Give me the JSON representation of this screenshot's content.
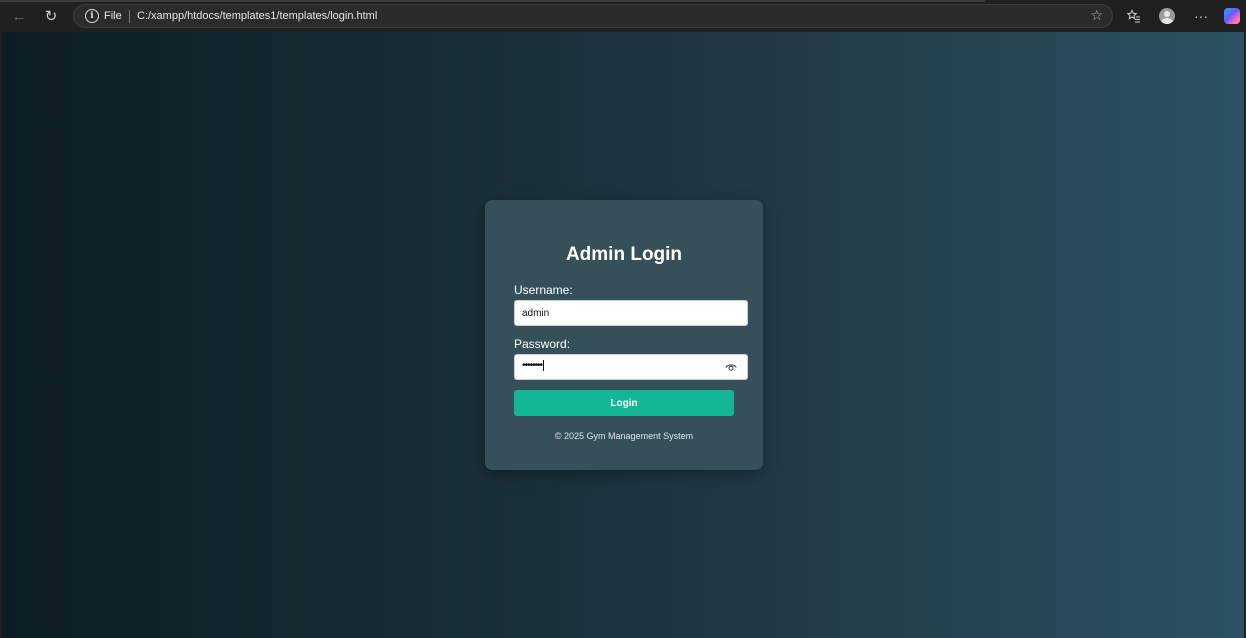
{
  "browser": {
    "back_icon": "←",
    "reload_icon": "↻",
    "info_icon": "i",
    "scheme": "File",
    "url": "C:/xampp/htdocs/templates1/templates/login.html",
    "star_icon": "☆",
    "favorites_icon": "☆",
    "menu_icon": "···"
  },
  "login": {
    "title": "Admin Login",
    "username_label": "Username:",
    "username_value": "admin",
    "password_label": "Password:",
    "password_value": "••••••••",
    "login_button": "Login",
    "footer": "© 2025 Gym Management System"
  },
  "colors": {
    "accent": "#13b795",
    "card": "#36505a"
  }
}
